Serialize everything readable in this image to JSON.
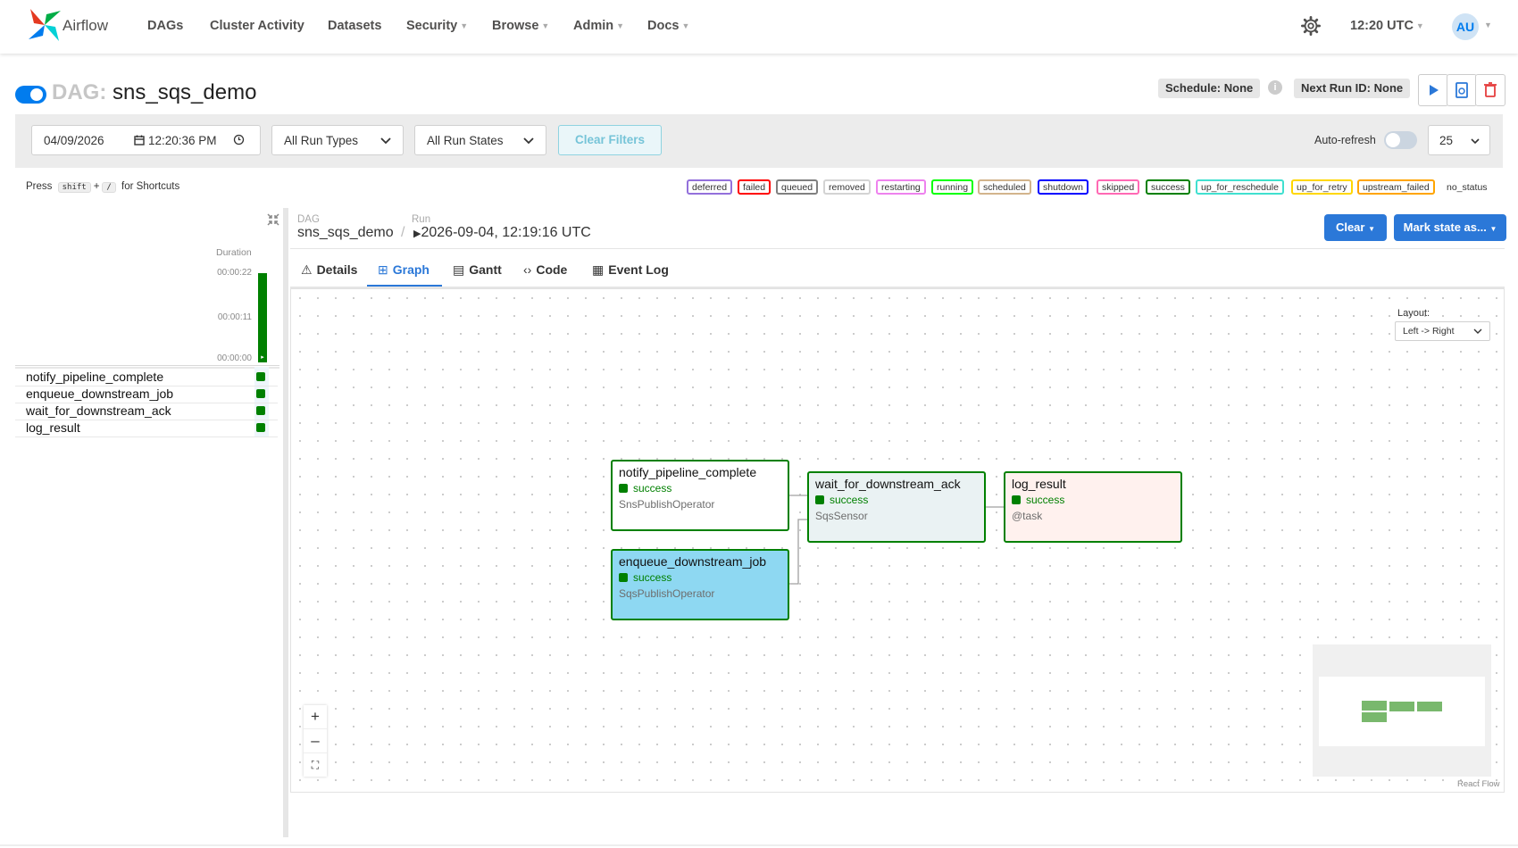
{
  "nav": {
    "brand": "Airflow",
    "items": [
      {
        "label": "DAGs",
        "dropdown": false
      },
      {
        "label": "Cluster Activity",
        "dropdown": false
      },
      {
        "label": "Datasets",
        "dropdown": false
      },
      {
        "label": "Security",
        "dropdown": true
      },
      {
        "label": "Browse",
        "dropdown": true
      },
      {
        "label": "Admin",
        "dropdown": true
      },
      {
        "label": "Docs",
        "dropdown": true
      }
    ],
    "time": "12:20 UTC",
    "user_initials": "AU"
  },
  "dag": {
    "prefix": "DAG:",
    "id": "sns_sqs_demo",
    "schedule": "Schedule: None",
    "next_run": "Next Run ID: None"
  },
  "filters": {
    "date": "04/09/2026",
    "time": "12:20:36 PM",
    "run_types": "All Run Types",
    "run_states": "All Run States",
    "clear_label": "Clear Filters",
    "auto_refresh": "Auto-refresh",
    "page_size": "25"
  },
  "shortcut": {
    "press": "Press",
    "key1": "shift",
    "plus": "+",
    "key2": "/",
    "suffix": "for Shortcuts"
  },
  "legend": [
    {
      "label": "deferred",
      "color": "#9370db"
    },
    {
      "label": "failed",
      "color": "#ff0000"
    },
    {
      "label": "queued",
      "color": "#808080"
    },
    {
      "label": "removed",
      "color": "#d3d3d3"
    },
    {
      "label": "restarting",
      "color": "#ee82ee"
    },
    {
      "label": "running",
      "color": "#00ff00"
    },
    {
      "label": "scheduled",
      "color": "#d2b48c"
    },
    {
      "label": "shutdown",
      "color": "#0000ff"
    },
    {
      "label": "skipped",
      "color": "#ff69b4"
    },
    {
      "label": "success",
      "color": "#008000"
    },
    {
      "label": "up_for_reschedule",
      "color": "#40e0d0"
    },
    {
      "label": "up_for_retry",
      "color": "#ffd700"
    },
    {
      "label": "upstream_failed",
      "color": "#ffa500"
    },
    {
      "label": "no_status",
      "color": "transparent"
    }
  ],
  "grid": {
    "duration_label": "Duration",
    "ticks": [
      "00:00:22",
      "00:00:11",
      "00:00:00"
    ],
    "tasks": [
      "notify_pipeline_complete",
      "enqueue_downstream_job",
      "wait_for_downstream_ack",
      "log_result"
    ]
  },
  "details": {
    "dag_label": "DAG",
    "dag_value": "sns_sqs_demo",
    "sep": "/",
    "run_label": "Run",
    "run_value": "2026-09-04, 12:19:16 UTC",
    "clear_btn": "Clear",
    "mark_btn": "Mark state as...",
    "tabs": [
      "Details",
      "Graph",
      "Gantt",
      "Code",
      "Event Log"
    ],
    "active_tab": "Graph"
  },
  "graph": {
    "layout_label": "Layout:",
    "layout_value": "Left -> Right",
    "nodes": [
      {
        "name": "notify_pipeline_complete",
        "state": "success",
        "operator": "SnsPublishOperator",
        "bg": "#ffffff"
      },
      {
        "name": "enqueue_downstream_job",
        "state": "success",
        "operator": "SqsPublishOperator",
        "bg": "#8ed8f2"
      },
      {
        "name": "wait_for_downstream_ack",
        "state": "success",
        "operator": "SqsSensor",
        "bg": "#eaf2f3"
      },
      {
        "name": "log_result",
        "state": "success",
        "operator": "@task",
        "bg": "#fff1ee"
      }
    ],
    "footer": "React Flow"
  },
  "colors": {
    "accent": "#017cee",
    "success": "#008000",
    "button": "#2b78d8"
  }
}
